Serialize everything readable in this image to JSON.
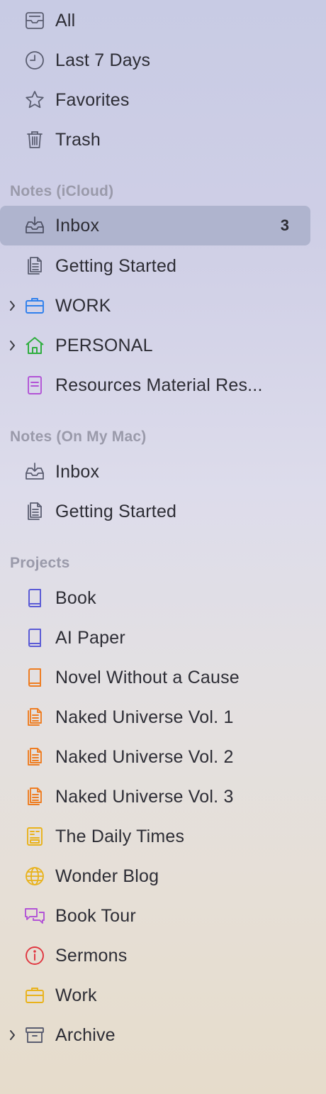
{
  "smart": [
    {
      "label": "All",
      "icon": "tray-stack-icon"
    },
    {
      "label": "Last 7 Days",
      "icon": "clock-icon"
    },
    {
      "label": "Favorites",
      "icon": "star-icon"
    },
    {
      "label": "Trash",
      "icon": "trash-icon"
    }
  ],
  "icloud": {
    "title": "Notes (iCloud)",
    "items": [
      {
        "label": "Inbox",
        "icon": "inbox-icon",
        "count": "3"
      },
      {
        "label": "Getting Started",
        "icon": "document-icon"
      },
      {
        "label": "WORK",
        "icon": "briefcase-icon"
      },
      {
        "label": "PERSONAL",
        "icon": "house-icon"
      },
      {
        "label": "Resources Material Res...",
        "icon": "notebook-icon"
      }
    ]
  },
  "mac": {
    "title": "Notes (On My Mac)",
    "items": [
      {
        "label": "Inbox",
        "icon": "inbox-icon"
      },
      {
        "label": "Getting Started",
        "icon": "document-icon"
      }
    ]
  },
  "projects": {
    "title": "Projects",
    "items": [
      {
        "label": "Book",
        "icon": "book-icon"
      },
      {
        "label": "AI Paper",
        "icon": "book-icon"
      },
      {
        "label": "Novel Without a Cause",
        "icon": "book-icon"
      },
      {
        "label": "Naked Universe Vol. 1",
        "icon": "document-icon"
      },
      {
        "label": "Naked Universe Vol. 2",
        "icon": "document-icon"
      },
      {
        "label": "Naked Universe Vol. 3",
        "icon": "document-icon"
      },
      {
        "label": "The Daily Times",
        "icon": "newspaper-icon"
      },
      {
        "label": "Wonder Blog",
        "icon": "globe-icon"
      },
      {
        "label": "Book Tour",
        "icon": "chat-bubbles-icon"
      },
      {
        "label": "Sermons",
        "icon": "info-icon"
      },
      {
        "label": "Work",
        "icon": "briefcase-icon"
      },
      {
        "label": "Archive",
        "icon": "archive-box-icon"
      }
    ]
  },
  "colors": {
    "gray": "#5a5d70",
    "indigo": "#5b5bd6",
    "orange": "#ee7d22",
    "yellow": "#e9b21a",
    "purple": "#b253d6",
    "red": "#e0353f",
    "blue": "#2f80ed",
    "green": "#2fae3f",
    "selected_bg": "#a9aec5"
  }
}
